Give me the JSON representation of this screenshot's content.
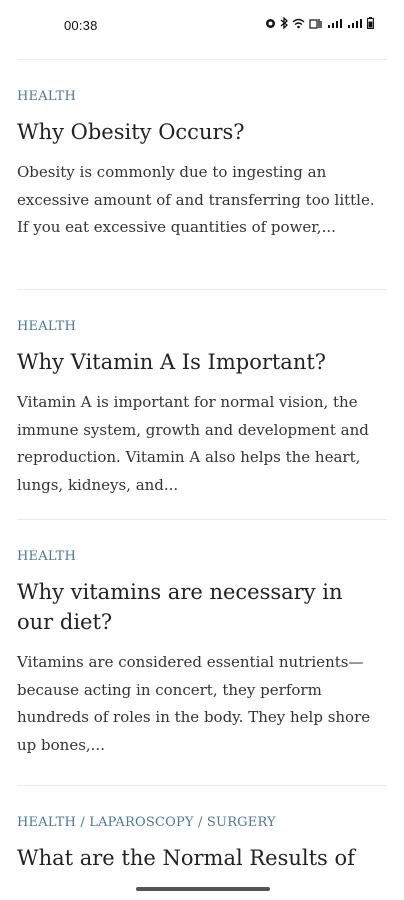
{
  "status_bar": {
    "time": "00:38",
    "icons": [
      "alarm-icon",
      "bluetooth-icon",
      "wifi-icon",
      "volte-icon",
      "signal-icon",
      "signal-icon",
      "battery-icon"
    ]
  },
  "articles": [
    {
      "tag": "HEALTH",
      "title": "Why Obesity Occurs?",
      "excerpt": "Obesity is commonly due to ingesting an excessive amount of and transferring too little. If you eat excessive quantities of power,..."
    },
    {
      "tag": "HEALTH",
      "title": "Why Vitamin A Is Important?",
      "excerpt": " Vitamin A is important for normal vision, the immune system, growth and development and reproduction.  Vitamin A also helps the heart, lungs, kidneys, and..."
    },
    {
      "tag": "HEALTH",
      "title": "Why vitamins are necessary in our diet?",
      "excerpt": "Vitamins  are considered essential nutrients—because acting in concert, they perform hundreds of roles in the body. They help shore up bones,..."
    },
    {
      "tag": "HEALTH / LAPAROSCOPY / SURGERY",
      "title": "What are the Normal Results of"
    }
  ]
}
